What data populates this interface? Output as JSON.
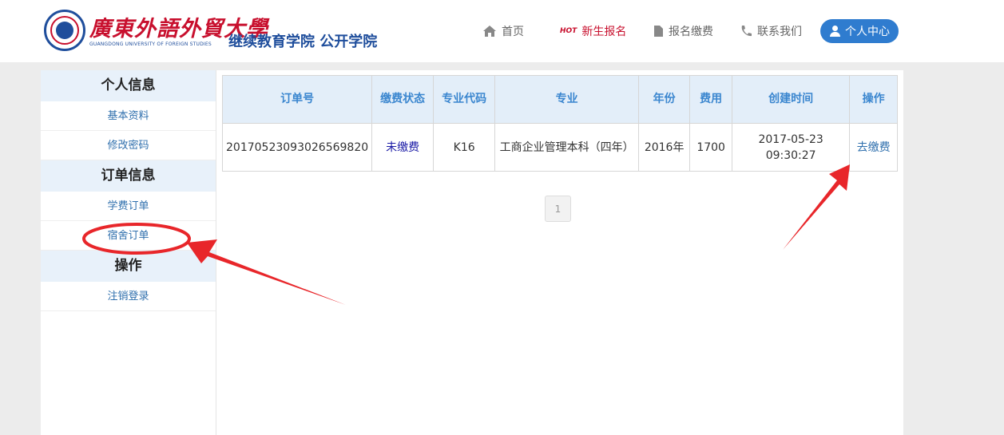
{
  "header": {
    "logo_cn": "廣東外語外貿大學",
    "logo_en": "GUANGDONG UNIVERSITY OF FOREIGN STUDIES",
    "logo_sub": "继续教育学院 公开学院",
    "nav": [
      {
        "label": "首页",
        "icon": "home-icon"
      },
      {
        "label": "新生报名",
        "badge": "HOT",
        "icon": "hot-flame-icon"
      },
      {
        "label": "报名缴费",
        "icon": "document-icon"
      },
      {
        "label": "联系我们",
        "icon": "phone-icon"
      }
    ],
    "user_button": "个人中心"
  },
  "sidebar": {
    "sections": [
      {
        "title": "个人信息",
        "items": [
          "基本资料",
          "修改密码"
        ]
      },
      {
        "title": "订单信息",
        "items": [
          "学费订单",
          "宿舍订单"
        ]
      },
      {
        "title": "操作",
        "items": [
          "注销登录"
        ]
      }
    ]
  },
  "table": {
    "columns": [
      "订单号",
      "缴费状态",
      "专业代码",
      "专业",
      "年份",
      "费用",
      "创建时间",
      "操作"
    ],
    "rows": [
      {
        "order_no": "20170523093026569820",
        "status": "未缴费",
        "major_code": "K16",
        "major": "工商企业管理本科（四年）",
        "year": "2016年",
        "fee": "1700",
        "created": "2017-05-23 09:30:27",
        "action": "去缴费"
      }
    ]
  },
  "pagination": {
    "current": "1"
  },
  "colors": {
    "brand_blue": "#1f4e9c",
    "brand_red": "#c8102e",
    "accent": "#2f7ccf",
    "annotation_red": "#e8262a"
  }
}
